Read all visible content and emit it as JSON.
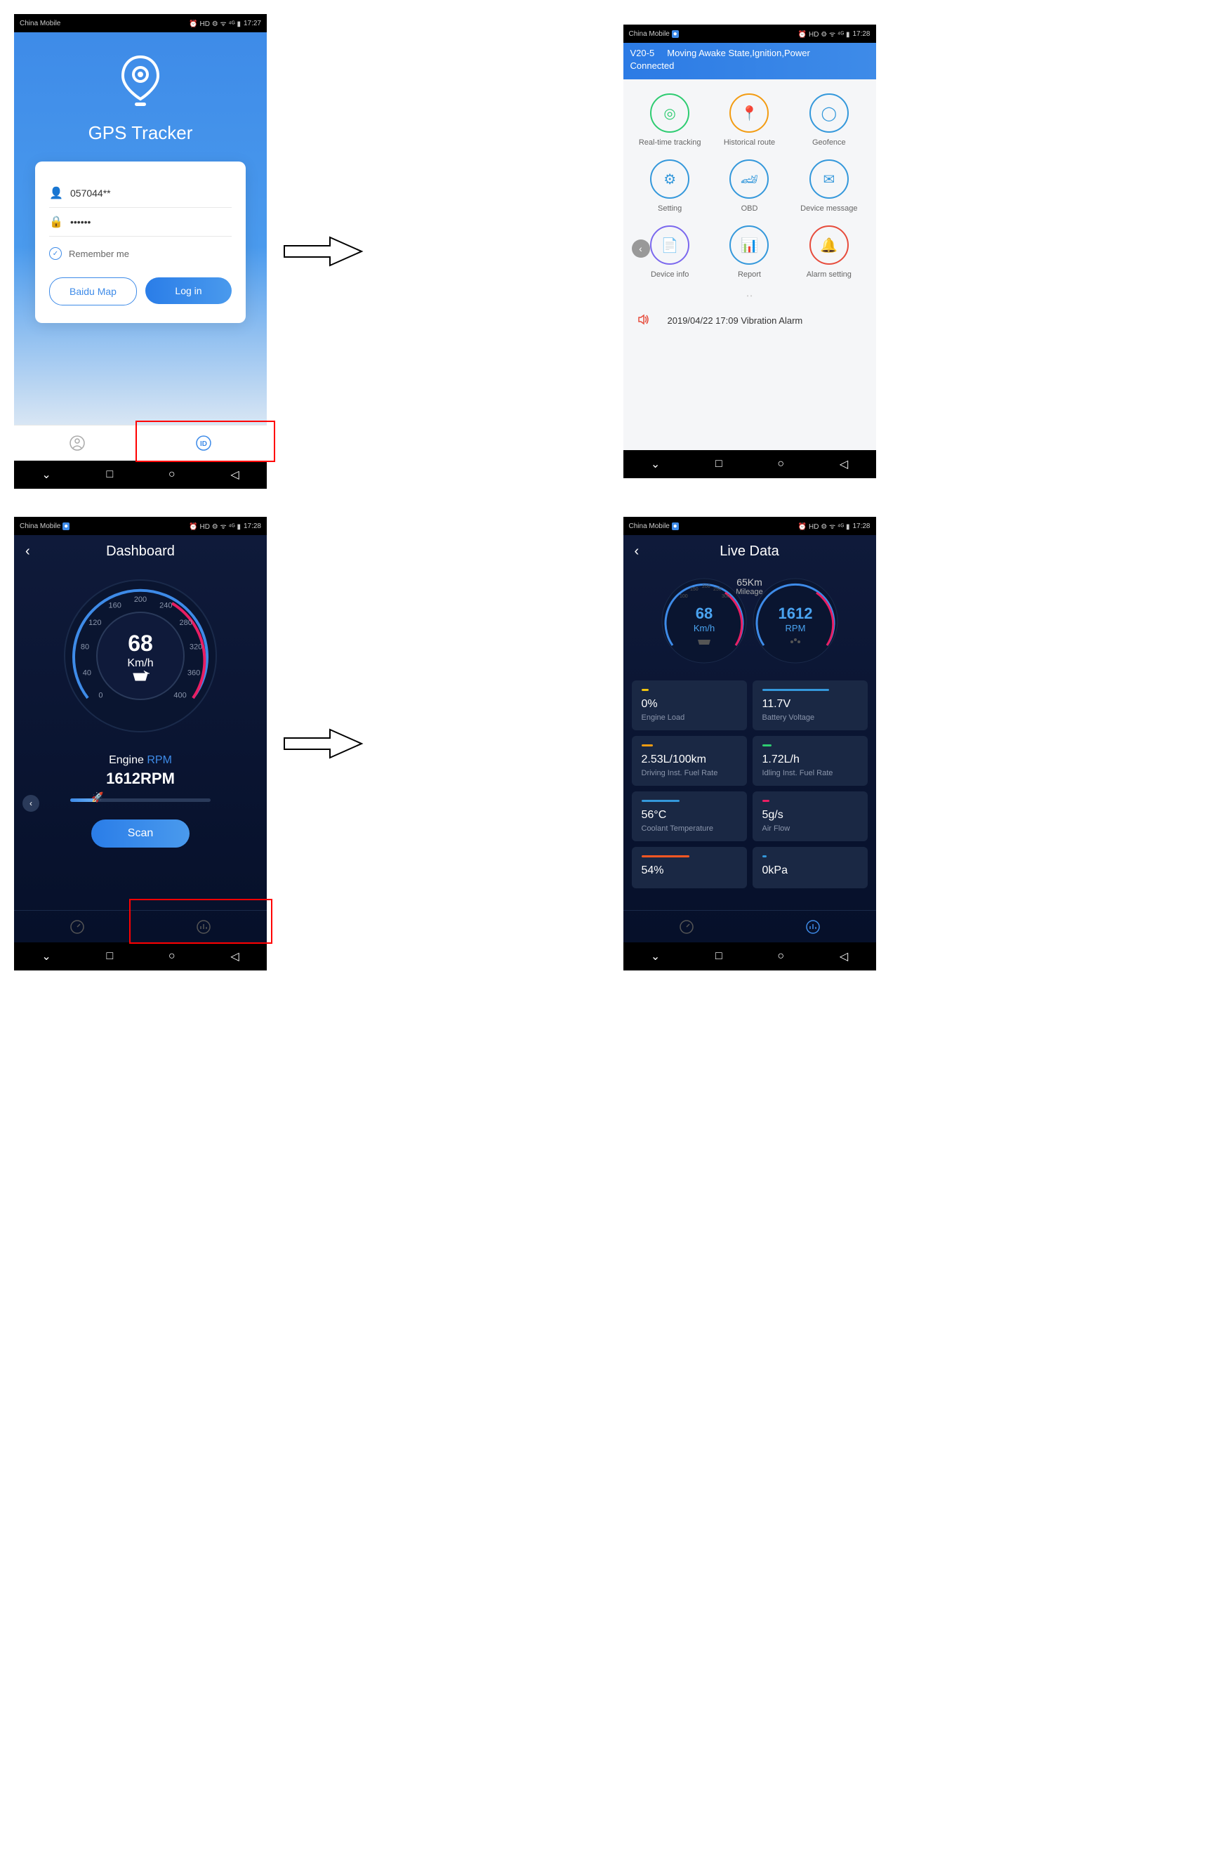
{
  "status_bar": {
    "carrier": "China Mobile",
    "time_1": "17:27",
    "time_2": "17:28"
  },
  "login": {
    "app_title": "GPS Tracker",
    "username": "057044**",
    "password": "••••••",
    "remember": "Remember me",
    "baidu_btn": "Baidu Map",
    "login_btn": "Log in"
  },
  "menu": {
    "header_line1": "V20-5",
    "header_line2": "Moving Awake State,Ignition,Power",
    "header_line3": "Connected",
    "items": [
      {
        "label": "Real-time tracking",
        "color": "#2ecc71"
      },
      {
        "label": "Historical route",
        "color": "#f39c12"
      },
      {
        "label": "Geofence",
        "color": "#3498db"
      },
      {
        "label": "Setting",
        "color": "#3498db"
      },
      {
        "label": "OBD",
        "color": "#3498db"
      },
      {
        "label": "Device message",
        "color": "#3498db"
      },
      {
        "label": "Device info",
        "color": "#7b68ee"
      },
      {
        "label": "Report",
        "color": "#3498db"
      },
      {
        "label": "Alarm setting",
        "color": "#e74c3c"
      }
    ],
    "alarm_msg": "2019/04/22 17:09 Vibration Alarm"
  },
  "dashboard": {
    "title": "Dashboard",
    "speed": "68",
    "speed_unit": "Km/h",
    "ticks": [
      "0",
      "40",
      "80",
      "120",
      "160",
      "200",
      "240",
      "280",
      "320",
      "360",
      "400"
    ],
    "engine_label": "Engine ",
    "engine_rpm_label": "RPM",
    "rpm_value": "1612RPM",
    "scan": "Scan"
  },
  "live": {
    "title": "Live Data",
    "mileage_val": "65Km",
    "mileage_lbl": "Mileage",
    "left_val": "68",
    "left_unit": "Km/h",
    "right_val": "1612",
    "right_unit": "RPM",
    "gauge_ticks": [
      "100",
      "150",
      "200",
      "250",
      "300"
    ],
    "cards": [
      {
        "val": "0%",
        "lbl": "Engine Load",
        "bar": "#f1c40f",
        "w": "8%"
      },
      {
        "val": "11.7V",
        "lbl": "Battery Voltage",
        "bar": "#3498db",
        "w": "70%"
      },
      {
        "val": "2.53L/100km",
        "lbl": "Driving Inst. Fuel Rate",
        "bar": "#f39c12",
        "w": "12%"
      },
      {
        "val": "1.72L/h",
        "lbl": "Idling Inst. Fuel Rate",
        "bar": "#2ecc71",
        "w": "10%"
      },
      {
        "val": "56°C",
        "lbl": "Coolant Temperature",
        "bar": "#3498db",
        "w": "40%"
      },
      {
        "val": "5g/s",
        "lbl": "Air Flow",
        "bar": "#e91e63",
        "w": "8%"
      },
      {
        "val": "54%",
        "lbl": "",
        "bar": "#ff5722",
        "w": "50%"
      },
      {
        "val": "0kPa",
        "lbl": "",
        "bar": "#3498db",
        "w": "5%"
      }
    ]
  }
}
